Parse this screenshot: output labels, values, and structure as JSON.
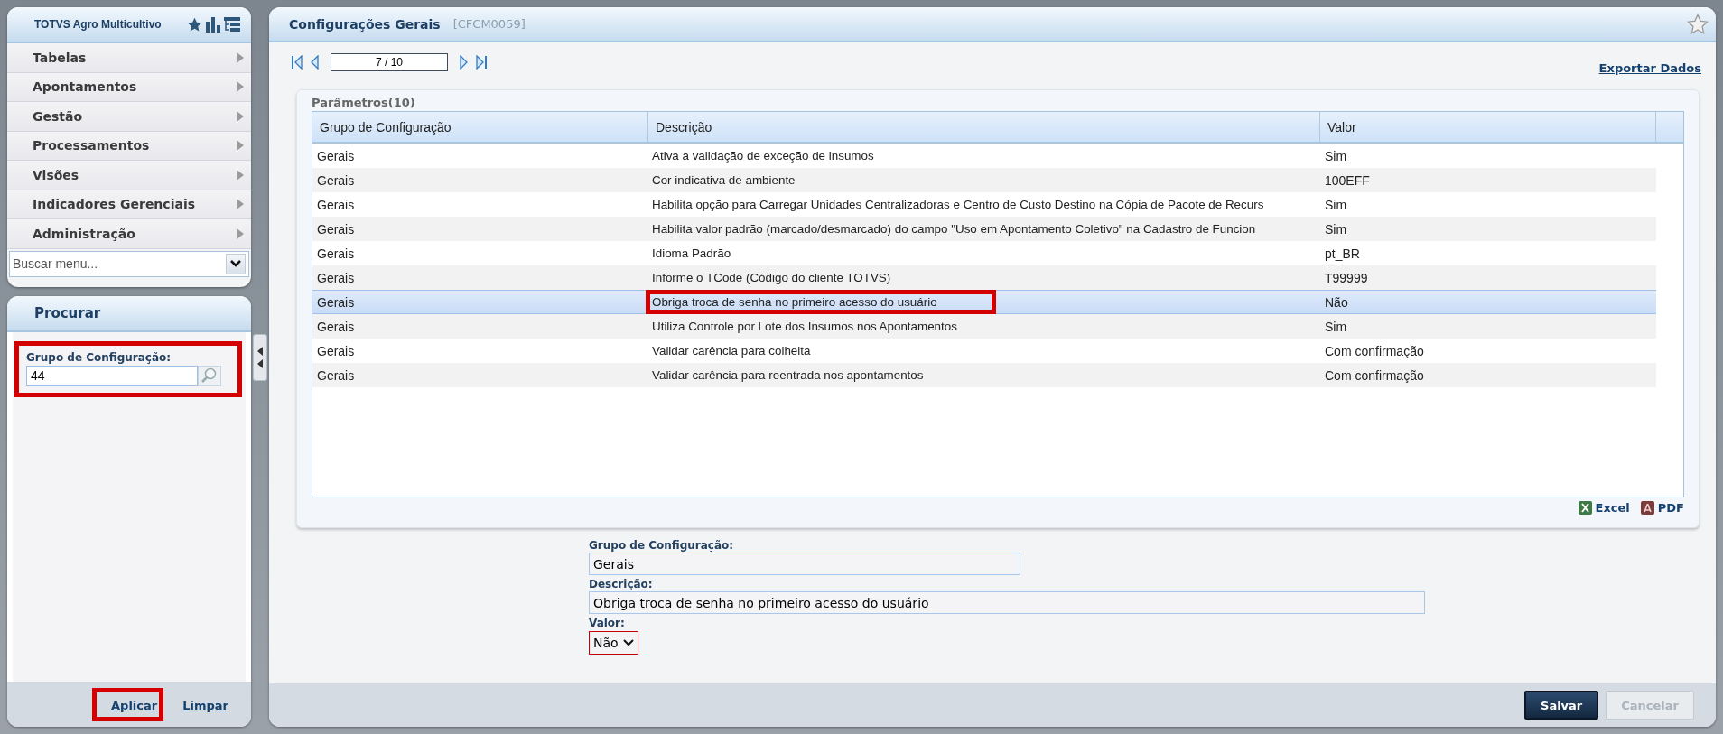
{
  "sidebar": {
    "title": "TOTVS Agro Multicultivo",
    "menu": [
      {
        "label": "Tabelas"
      },
      {
        "label": "Apontamentos"
      },
      {
        "label": "Gestão"
      },
      {
        "label": "Processamentos"
      },
      {
        "label": "Visões"
      },
      {
        "label": "Indicadores Gerenciais"
      },
      {
        "label": "Administração"
      }
    ],
    "menu_search": {
      "placeholder": "Buscar menu..."
    }
  },
  "search_panel": {
    "title": "Procurar",
    "field": {
      "label": "Grupo de Configuração:",
      "value": "44",
      "highlighted": true
    },
    "actions": [
      {
        "label": "Aplicar",
        "highlighted": true
      },
      {
        "label": "Limpar",
        "highlighted": false
      }
    ]
  },
  "page": {
    "title": "Configurações Gerais",
    "code": "[CFCM0059]",
    "pager": {
      "value": "7 / 10"
    },
    "export_link": "Exportar Dados"
  },
  "grid": {
    "title": "Parâmetros(10)",
    "columns": [
      "Grupo de Configuração",
      "Descrição",
      "Valor"
    ],
    "rows": [
      {
        "group": "Gerais",
        "description": "Ativa a validação de exceção de insumos",
        "value": "Sim",
        "selected": false,
        "highlighted": false
      },
      {
        "group": "Gerais",
        "description": "Cor indicativa de ambiente",
        "value": "100EFF",
        "selected": false,
        "highlighted": false
      },
      {
        "group": "Gerais",
        "description": "Habilita opção para Carregar Unidades Centralizadoras e Centro de Custo Destino na Cópia de Pacote de Recurs",
        "value": "Sim",
        "selected": false,
        "highlighted": false
      },
      {
        "group": "Gerais",
        "description": "Habilita valor padrão (marcado/desmarcado) do campo \"Uso em Apontamento Coletivo\" na Cadastro de Funcion",
        "value": "Sim",
        "selected": false,
        "highlighted": false
      },
      {
        "group": "Gerais",
        "description": "Idioma Padrão",
        "value": "pt_BR",
        "selected": false,
        "highlighted": false
      },
      {
        "group": "Gerais",
        "description": "Informe o TCode (Código do cliente TOTVS)",
        "value": "T99999",
        "selected": false,
        "highlighted": false
      },
      {
        "group": "Gerais",
        "description": "Obriga troca de senha no primeiro acesso do usuário",
        "value": "Não",
        "selected": true,
        "highlighted": true
      },
      {
        "group": "Gerais",
        "description": "Utiliza Controle por Lote dos Insumos nos Apontamentos",
        "value": "Sim",
        "selected": false,
        "highlighted": false
      },
      {
        "group": "Gerais",
        "description": "Validar carência para colheita",
        "value": "Com confirmação",
        "selected": false,
        "highlighted": false
      },
      {
        "group": "Gerais",
        "description": "Validar carência para reentrada nos apontamentos",
        "value": "Com confirmação",
        "selected": false,
        "highlighted": false
      }
    ],
    "exports": [
      {
        "kind": "excel",
        "label": "Excel"
      },
      {
        "kind": "pdf",
        "label": "PDF"
      }
    ]
  },
  "form": {
    "fields": [
      {
        "kind": "text",
        "label": "Grupo de Configuração:",
        "value": "Gerais",
        "highlighted": false
      },
      {
        "kind": "text",
        "label": "Descrição:",
        "value": "Obriga troca de senha no primeiro acesso do usuário",
        "highlighted": false
      },
      {
        "kind": "select",
        "label": "Valor:",
        "value": "Não",
        "highlighted": true
      }
    ]
  },
  "buttons": [
    {
      "label": "Salvar",
      "disabled": false
    },
    {
      "label": "Cancelar",
      "disabled": true
    }
  ]
}
